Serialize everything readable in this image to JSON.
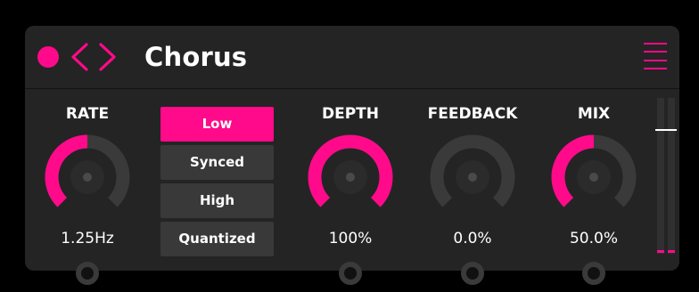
{
  "colors": {
    "accent": "#ff0a8a",
    "panel": "#242424",
    "track": "#3a3a3a",
    "background": "#000000",
    "text": "#ffffff"
  },
  "header": {
    "title": "Chorus",
    "power_icon": "power-dot-icon",
    "prev_icon": "chevron-left-icon",
    "next_icon": "chevron-right-icon",
    "menu_icon": "hamburger-menu-icon"
  },
  "knobs": {
    "rate": {
      "label": "RATE",
      "value": "1.25Hz",
      "fill": 0.5
    },
    "depth": {
      "label": "DEPTH",
      "value": "100%",
      "fill": 1.0
    },
    "feedback": {
      "label": "FEEDBACK",
      "value": "0.0%",
      "fill": 0.0
    },
    "mix": {
      "label": "MIX",
      "value": "50.0%",
      "fill": 0.5
    }
  },
  "rate_mode": {
    "options": [
      "Low",
      "Synced",
      "High",
      "Quantized"
    ],
    "selected": "Low"
  },
  "meter": {
    "level": 0.8
  }
}
